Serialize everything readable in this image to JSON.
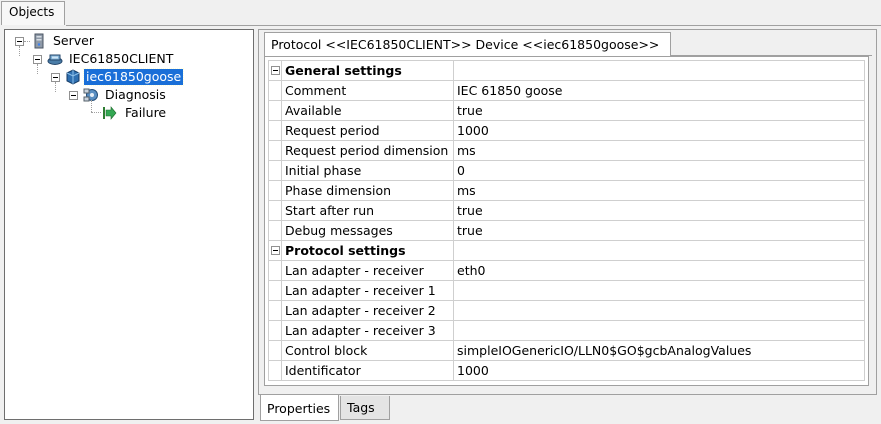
{
  "top_tab": {
    "label": "Objects"
  },
  "tree": {
    "nodes": [
      {
        "label": "Server",
        "icon": "server-icon"
      },
      {
        "label": "IEC61850CLIENT",
        "icon": "network-client-icon"
      },
      {
        "label": "iec61850goose",
        "icon": "device-icon",
        "selected": true
      },
      {
        "label": "Diagnosis",
        "icon": "diagnosis-gear-icon"
      },
      {
        "label": "Failure",
        "icon": "green-arrow-icon"
      }
    ]
  },
  "inner_tab": {
    "label": "Protocol <<IEC61850CLIENT>> Device <<iec61850goose>>"
  },
  "properties": {
    "general_section": "General settings",
    "rows_general": [
      {
        "name": "Comment",
        "value": "IEC 61850 goose"
      },
      {
        "name": "Available",
        "value": "true"
      },
      {
        "name": "Request period",
        "value": "1000"
      },
      {
        "name": "Request period dimension",
        "value": "ms"
      },
      {
        "name": "Initial phase",
        "value": "0"
      },
      {
        "name": "Phase dimension",
        "value": "ms"
      },
      {
        "name": "Start after run",
        "value": "true"
      },
      {
        "name": "Debug messages",
        "value": "true"
      }
    ],
    "protocol_section": "Protocol settings",
    "rows_protocol": [
      {
        "name": "Lan adapter - receiver",
        "value": "eth0"
      },
      {
        "name": "Lan adapter - receiver 1",
        "value": ""
      },
      {
        "name": "Lan adapter - receiver 2",
        "value": ""
      },
      {
        "name": "Lan adapter - receiver 3",
        "value": ""
      },
      {
        "name": "Control block",
        "value": "simpleIOGenericIO/LLN0$GO$gcbAnalogValues"
      },
      {
        "name": "Identificator",
        "value": "1000"
      }
    ]
  },
  "bottom_tabs": {
    "properties": "Properties",
    "tags": "Tags"
  },
  "colors": {
    "selection": "#1a6fd8",
    "panel_border": "#a0a0a0"
  }
}
